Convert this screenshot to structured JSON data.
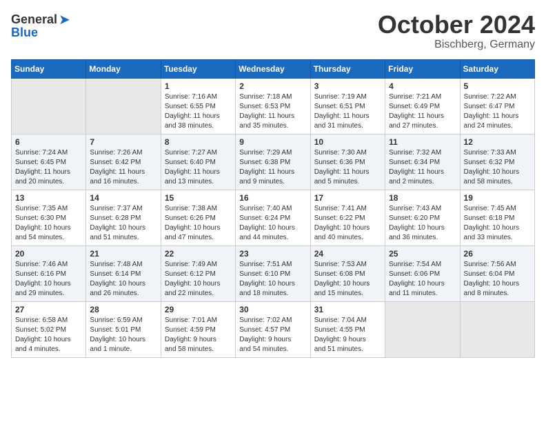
{
  "header": {
    "logo_general": "General",
    "logo_blue": "Blue",
    "month": "October 2024",
    "location": "Bischberg, Germany"
  },
  "weekdays": [
    "Sunday",
    "Monday",
    "Tuesday",
    "Wednesday",
    "Thursday",
    "Friday",
    "Saturday"
  ],
  "weeks": [
    [
      {
        "day": "",
        "info": ""
      },
      {
        "day": "",
        "info": ""
      },
      {
        "day": "1",
        "info": "Sunrise: 7:16 AM\nSunset: 6:55 PM\nDaylight: 11 hours\nand 38 minutes."
      },
      {
        "day": "2",
        "info": "Sunrise: 7:18 AM\nSunset: 6:53 PM\nDaylight: 11 hours\nand 35 minutes."
      },
      {
        "day": "3",
        "info": "Sunrise: 7:19 AM\nSunset: 6:51 PM\nDaylight: 11 hours\nand 31 minutes."
      },
      {
        "day": "4",
        "info": "Sunrise: 7:21 AM\nSunset: 6:49 PM\nDaylight: 11 hours\nand 27 minutes."
      },
      {
        "day": "5",
        "info": "Sunrise: 7:22 AM\nSunset: 6:47 PM\nDaylight: 11 hours\nand 24 minutes."
      }
    ],
    [
      {
        "day": "6",
        "info": "Sunrise: 7:24 AM\nSunset: 6:45 PM\nDaylight: 11 hours\nand 20 minutes."
      },
      {
        "day": "7",
        "info": "Sunrise: 7:26 AM\nSunset: 6:42 PM\nDaylight: 11 hours\nand 16 minutes."
      },
      {
        "day": "8",
        "info": "Sunrise: 7:27 AM\nSunset: 6:40 PM\nDaylight: 11 hours\nand 13 minutes."
      },
      {
        "day": "9",
        "info": "Sunrise: 7:29 AM\nSunset: 6:38 PM\nDaylight: 11 hours\nand 9 minutes."
      },
      {
        "day": "10",
        "info": "Sunrise: 7:30 AM\nSunset: 6:36 PM\nDaylight: 11 hours\nand 5 minutes."
      },
      {
        "day": "11",
        "info": "Sunrise: 7:32 AM\nSunset: 6:34 PM\nDaylight: 11 hours\nand 2 minutes."
      },
      {
        "day": "12",
        "info": "Sunrise: 7:33 AM\nSunset: 6:32 PM\nDaylight: 10 hours\nand 58 minutes."
      }
    ],
    [
      {
        "day": "13",
        "info": "Sunrise: 7:35 AM\nSunset: 6:30 PM\nDaylight: 10 hours\nand 54 minutes."
      },
      {
        "day": "14",
        "info": "Sunrise: 7:37 AM\nSunset: 6:28 PM\nDaylight: 10 hours\nand 51 minutes."
      },
      {
        "day": "15",
        "info": "Sunrise: 7:38 AM\nSunset: 6:26 PM\nDaylight: 10 hours\nand 47 minutes."
      },
      {
        "day": "16",
        "info": "Sunrise: 7:40 AM\nSunset: 6:24 PM\nDaylight: 10 hours\nand 44 minutes."
      },
      {
        "day": "17",
        "info": "Sunrise: 7:41 AM\nSunset: 6:22 PM\nDaylight: 10 hours\nand 40 minutes."
      },
      {
        "day": "18",
        "info": "Sunrise: 7:43 AM\nSunset: 6:20 PM\nDaylight: 10 hours\nand 36 minutes."
      },
      {
        "day": "19",
        "info": "Sunrise: 7:45 AM\nSunset: 6:18 PM\nDaylight: 10 hours\nand 33 minutes."
      }
    ],
    [
      {
        "day": "20",
        "info": "Sunrise: 7:46 AM\nSunset: 6:16 PM\nDaylight: 10 hours\nand 29 minutes."
      },
      {
        "day": "21",
        "info": "Sunrise: 7:48 AM\nSunset: 6:14 PM\nDaylight: 10 hours\nand 26 minutes."
      },
      {
        "day": "22",
        "info": "Sunrise: 7:49 AM\nSunset: 6:12 PM\nDaylight: 10 hours\nand 22 minutes."
      },
      {
        "day": "23",
        "info": "Sunrise: 7:51 AM\nSunset: 6:10 PM\nDaylight: 10 hours\nand 18 minutes."
      },
      {
        "day": "24",
        "info": "Sunrise: 7:53 AM\nSunset: 6:08 PM\nDaylight: 10 hours\nand 15 minutes."
      },
      {
        "day": "25",
        "info": "Sunrise: 7:54 AM\nSunset: 6:06 PM\nDaylight: 10 hours\nand 11 minutes."
      },
      {
        "day": "26",
        "info": "Sunrise: 7:56 AM\nSunset: 6:04 PM\nDaylight: 10 hours\nand 8 minutes."
      }
    ],
    [
      {
        "day": "27",
        "info": "Sunrise: 6:58 AM\nSunset: 5:02 PM\nDaylight: 10 hours\nand 4 minutes."
      },
      {
        "day": "28",
        "info": "Sunrise: 6:59 AM\nSunset: 5:01 PM\nDaylight: 10 hours\nand 1 minute."
      },
      {
        "day": "29",
        "info": "Sunrise: 7:01 AM\nSunset: 4:59 PM\nDaylight: 9 hours\nand 58 minutes."
      },
      {
        "day": "30",
        "info": "Sunrise: 7:02 AM\nSunset: 4:57 PM\nDaylight: 9 hours\nand 54 minutes."
      },
      {
        "day": "31",
        "info": "Sunrise: 7:04 AM\nSunset: 4:55 PM\nDaylight: 9 hours\nand 51 minutes."
      },
      {
        "day": "",
        "info": ""
      },
      {
        "day": "",
        "info": ""
      }
    ]
  ]
}
